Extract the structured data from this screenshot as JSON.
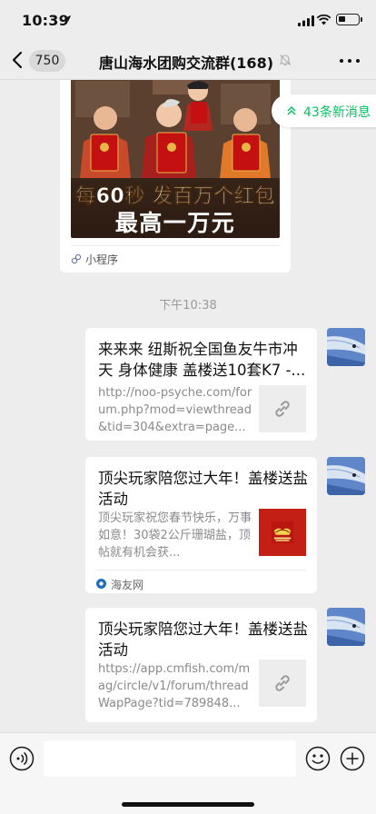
{
  "status_bar": {
    "time": "10:39"
  },
  "nav": {
    "unread_badge": "750",
    "title": "唐山海水团购交流群(168)"
  },
  "chat": {
    "mini_program_card": {
      "promo_line1": "每60秒 发百万个红包",
      "promo_line2": "最高一万元",
      "footer_label": "小程序"
    },
    "new_messages_pill": "43条新消息",
    "timestamp": "下午10:38",
    "messages": [
      {
        "title": "来来来 纽斯祝全国鱼友牛市冲天 身体健康 盖楼送10套K7 -...",
        "desc": "http://noo-psyche.com/forum.php?mod=viewthread&tid=304&extra=page...",
        "thumb_icon": "link-icon"
      },
      {
        "title": "顶尖玩家陪您过大年！盖楼送盐活动",
        "desc": "顶尖玩家祝您春节快乐，万事如意！30袋2公斤珊瑚盐，顶帖就有机会获...",
        "thumb_icon": "promo-image",
        "source": "海友网"
      },
      {
        "title": "顶尖玩家陪您过大年！盖楼送盐活动",
        "desc": "https://app.cmfish.com/mag/circle/v1/forum/threadWapPage?tid=789848...",
        "thumb_icon": "link-icon"
      }
    ]
  },
  "input_bar": {
    "voice_icon": "voice-icon",
    "emoji_icon": "emoji-icon",
    "plus_icon": "plus-icon"
  },
  "colors": {
    "accent_green": "#07c160",
    "chat_bg": "#ededed"
  }
}
